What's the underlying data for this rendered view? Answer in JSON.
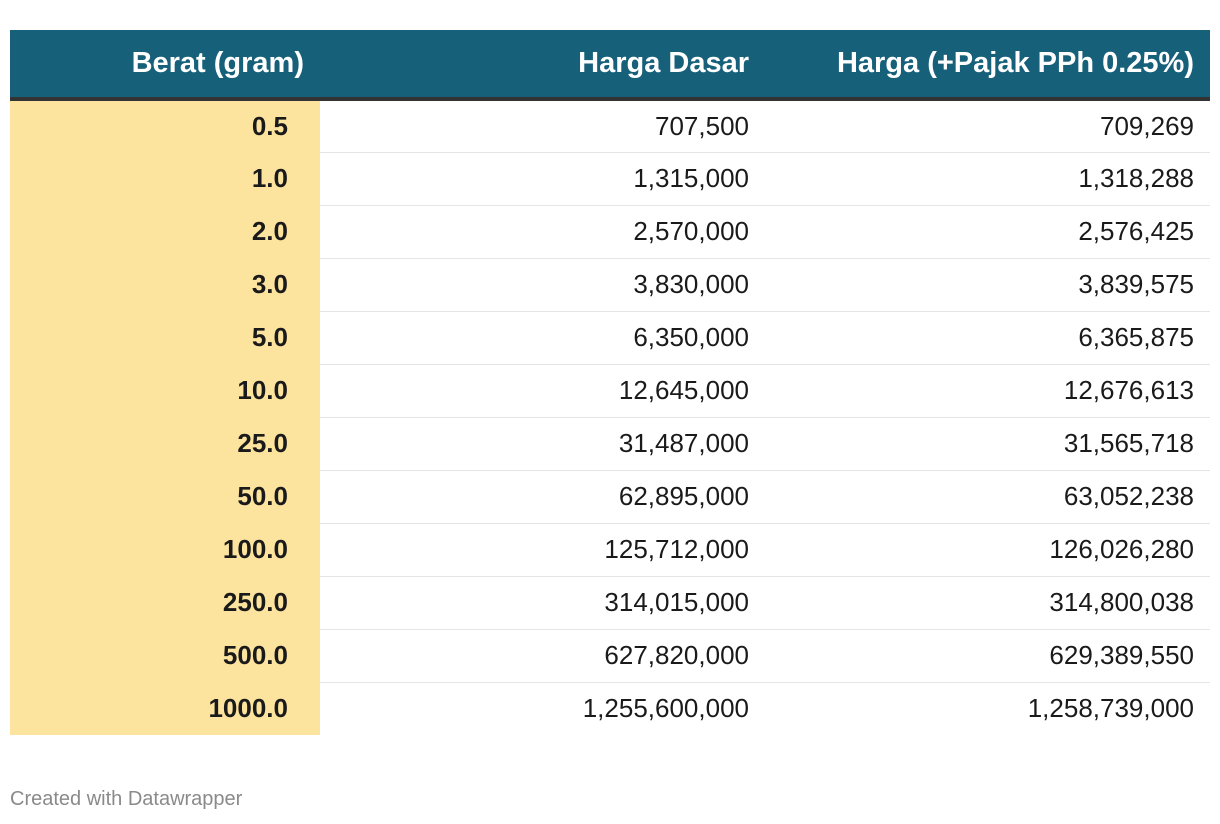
{
  "chart_data": {
    "type": "table",
    "columns": [
      "Berat (gram)",
      "Harga Dasar",
      "Harga (+Pajak PPh 0.25%)"
    ],
    "rows": [
      [
        "0.5",
        "707,500",
        "709,269"
      ],
      [
        "1.0",
        "1,315,000",
        "1,318,288"
      ],
      [
        "2.0",
        "2,570,000",
        "2,576,425"
      ],
      [
        "3.0",
        "3,830,000",
        "3,839,575"
      ],
      [
        "5.0",
        "6,350,000",
        "6,365,875"
      ],
      [
        "10.0",
        "12,645,000",
        "12,676,613"
      ],
      [
        "25.0",
        "31,487,000",
        "31,565,718"
      ],
      [
        "50.0",
        "62,895,000",
        "63,052,238"
      ],
      [
        "100.0",
        "125,712,000",
        "126,026,280"
      ],
      [
        "250.0",
        "314,015,000",
        "314,800,038"
      ],
      [
        "500.0",
        "627,820,000",
        "629,389,550"
      ],
      [
        "1000.0",
        "1,255,600,000",
        "1,258,739,000"
      ]
    ]
  },
  "colors": {
    "header_bg": "#16607a",
    "highlight_column": "#fde49e"
  },
  "footer": {
    "credit": "Created with Datawrapper"
  }
}
